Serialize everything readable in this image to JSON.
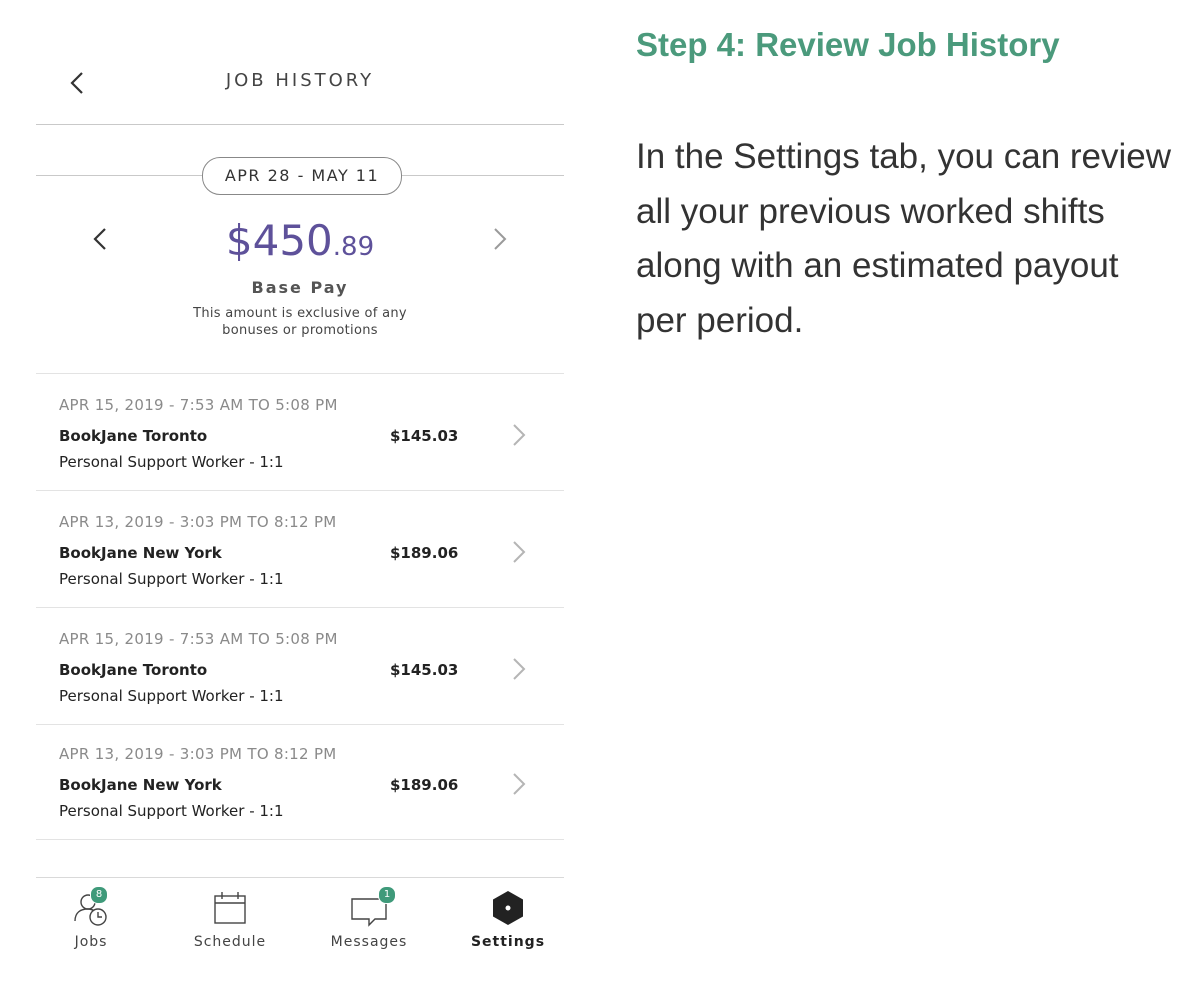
{
  "screen": {
    "title": "JOB HISTORY",
    "period_label": "APR 28 - MAY 11",
    "amount_main": "$450",
    "amount_cents": ".89",
    "base_pay_label": "Base Pay",
    "disclaimer_line1": "This amount is exclusive of any",
    "disclaimer_line2": "bonuses or promotions"
  },
  "shifts": [
    {
      "date": "APR 15, 2019 - 7:53 AM TO 5:08 PM",
      "company": "BookJane Toronto",
      "role": "Personal Support Worker - 1:1",
      "amount": "$145.03"
    },
    {
      "date": "APR 13, 2019 - 3:03 PM TO 8:12 PM",
      "company": "BookJane New York",
      "role": "Personal Support Worker - 1:1",
      "amount": "$189.06"
    },
    {
      "date": "APR 15, 2019 - 7:53 AM TO 5:08 PM",
      "company": "BookJane Toronto",
      "role": "Personal Support Worker - 1:1",
      "amount": "$145.03"
    },
    {
      "date": "APR 13, 2019 - 3:03 PM TO 8:12 PM",
      "company": "BookJane New York",
      "role": "Personal Support Worker - 1:1",
      "amount": "$189.06"
    }
  ],
  "tabs": [
    {
      "label": "Jobs",
      "icon": "jobs-clock-icon",
      "badge": "8"
    },
    {
      "label": "Schedule",
      "icon": "calendar-icon"
    },
    {
      "label": "Messages",
      "icon": "message-bubble-icon",
      "badge": "1"
    },
    {
      "label": "Settings",
      "icon": "settings-hexagon-icon",
      "active": true
    }
  ],
  "step": {
    "title": "Step 4: Review Job History",
    "body": "In the Settings tab, you can review all your previous worked shifts along with an estimated payout per period."
  },
  "colors": {
    "accent_purple": "#5e519a",
    "step_green": "#4b9a7c",
    "badge_green": "#3f9a7a"
  }
}
